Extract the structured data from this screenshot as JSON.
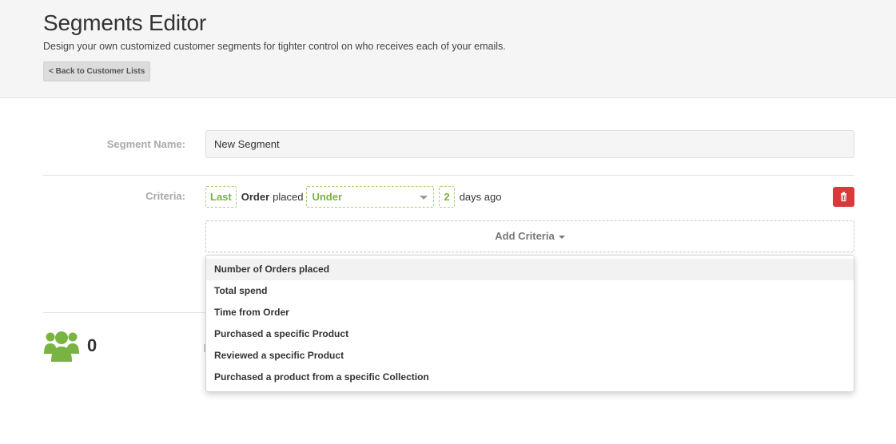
{
  "header": {
    "title": "Segments Editor",
    "subtitle": "Design your own customized customer segments for tighter control on who receives each of your emails.",
    "back_label": "< Back to Customer Lists"
  },
  "form": {
    "segment_name_label": "Segment Name:",
    "segment_name_value": "New Segment",
    "criteria_label": "Criteria:"
  },
  "criteria": {
    "timeframe": "Last",
    "entity": "Order",
    "verb": "placed",
    "comparator": "Under",
    "amount": "2",
    "unit": "days ago"
  },
  "add_criteria_label": "Add Criteria",
  "dropdown": {
    "items": [
      "Number of Orders placed",
      "Total spend",
      "Time from Order",
      "Purchased a specific Product",
      "Reviewed a specific Product",
      "Purchased a product from a specific Collection"
    ]
  },
  "customer_count": "0",
  "colors": {
    "accent_green": "#79b341",
    "delete_red": "#d9393a"
  },
  "icons": {
    "users": "users-group-icon",
    "delete": "trash-icon",
    "select": "caret-down-icon"
  }
}
